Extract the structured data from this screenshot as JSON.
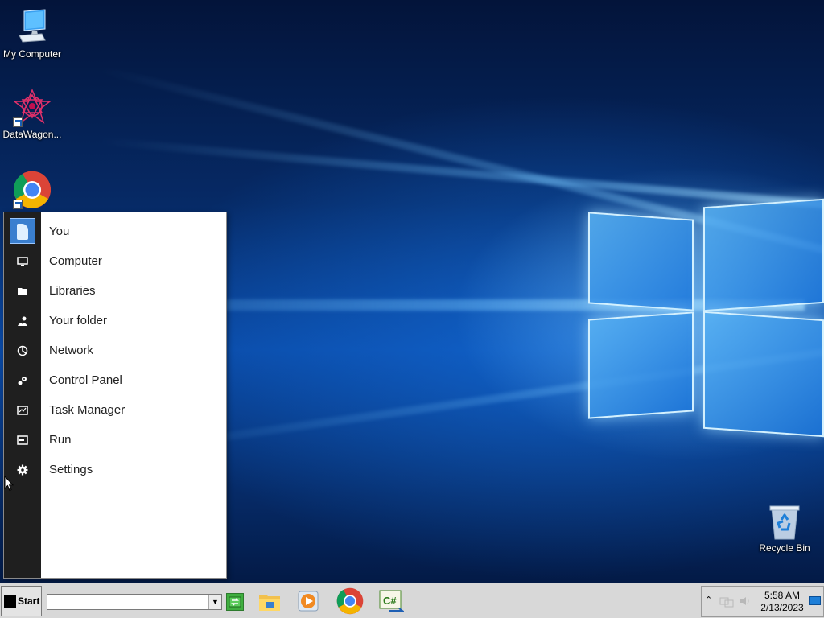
{
  "desktop": {
    "icons": [
      {
        "label": "My Computer",
        "icon": "my-computer-icon"
      },
      {
        "label": "DataWagon...",
        "icon": "datawagon-icon"
      },
      {
        "label": "",
        "icon": "chrome-icon"
      },
      {
        "label": "Recycle Bin",
        "icon": "recycle-bin-icon"
      }
    ]
  },
  "start_menu": {
    "items": [
      {
        "label": "You",
        "icon": "user-tile-icon"
      },
      {
        "label": "Computer",
        "icon": "monitor-icon"
      },
      {
        "label": "Libraries",
        "icon": "folder-icon"
      },
      {
        "label": "Your folder",
        "icon": "users-icon"
      },
      {
        "label": "Network",
        "icon": "network-icon"
      },
      {
        "label": "Control Panel",
        "icon": "control-panel-icon"
      },
      {
        "label": "Task Manager",
        "icon": "task-manager-icon"
      },
      {
        "label": "Run",
        "icon": "run-icon"
      },
      {
        "label": "Settings",
        "icon": "gear-icon"
      }
    ]
  },
  "taskbar": {
    "start_label": "Start",
    "run_value": "",
    "apps": [
      "file-explorer-icon",
      "media-player-icon",
      "chrome-icon",
      "csharp-editor-icon"
    ],
    "tray": {
      "time": "5:58 AM",
      "date": "2/13/2023"
    }
  },
  "colors": {
    "rail": "#1f1f1f",
    "accent": "#1e7fd8",
    "taskbar": "#d8d8d8"
  }
}
